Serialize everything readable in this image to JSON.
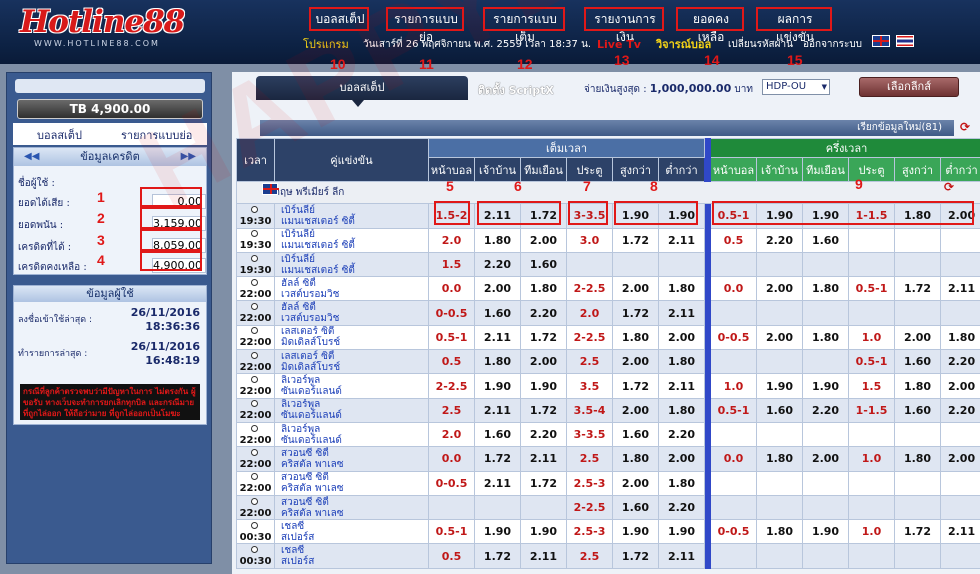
{
  "header": {
    "logo": "Hotline88",
    "logo_sub": "WWW.HOTLINE88.COM",
    "menu": [
      {
        "label": "บอลสเต็ป",
        "num": "10"
      },
      {
        "label": "รายการแบบย่อ",
        "num": "11"
      },
      {
        "label": "รายการแบบเต็ม",
        "num": "12"
      },
      {
        "label": "รายงานการเงิน",
        "num": "13"
      },
      {
        "label": "ยอดคงเหลือ",
        "num": "14"
      },
      {
        "label": "ผลการแข่งขัน",
        "num": "15"
      }
    ],
    "promo": "โปรแกรม",
    "datetime": "วันเสาร์ที่ 26 พฤศจิกายน พ.ศ. 2559 เวลา 18:37 น.",
    "livetv": "Live Tv",
    "analysis": "วิจารณ์บอล",
    "change_password": "เปลี่ยนรหัสผ่าน",
    "logout": "ออกจากระบบ",
    "colors": {
      "accent_red": "#e01818",
      "yellow": "#f5d416",
      "nav_bg": "#0d2244"
    }
  },
  "left": {
    "balance": "TB 4,900.00",
    "tabs": [
      "บอลสเต็ป",
      "รายการแบบย่อ"
    ],
    "credit_title": "ข้อมูลเครดิต",
    "username_label": "ชื่อผู้ใช้ :",
    "credit_rows": [
      {
        "label": "ยอดได้เสีย :",
        "value": "0.00",
        "num": "1"
      },
      {
        "label": "ยอดพนัน :",
        "value": "3,159.00",
        "num": "2"
      },
      {
        "label": "เครดิตที่ได้ :",
        "value": "8,059.00",
        "num": "3"
      },
      {
        "label": "เครดิตคงเหลือ :",
        "value": "4,900.00",
        "num": "4"
      }
    ],
    "user_title": "ข้อมูลผู้ใช้",
    "last_login_label": "ลงชื่อเข้าใช้ล่าสุด :",
    "last_login": "26/11/2016",
    "last_login_time": "18:36:36",
    "last_tx_label": "ทำรายการล่าสุด :",
    "last_tx": "26/11/2016",
    "last_tx_time": "16:48:19",
    "notice": "กรณีที่ลูกค้าตรวจพบว่ามีปัญหาในการ ไม่ตรงกัน ผู้ขอรับ ทางเว็บจะทำการยกเลิกทุกบิล และกรณีมายที่ถูกไล่ออก ให้ถือว่ามาย ที่ถูกไล่ออกเป็นโมฆะ"
  },
  "main": {
    "tab_label": "บอลสเต็ป",
    "script_tab": "ติดตั้ง ScriptX",
    "max_pay_label": "จ่ายเงินสูงสุด :",
    "max_pay_value": "1,000,000.00",
    "max_pay_unit": "บาท",
    "market": "HDP-OU",
    "league_button": "เลือกลีกส์",
    "refresh": "เรียกข้อมูลใหม่(81)",
    "col_time": "เวลา",
    "col_match": "คู่แข่งขัน",
    "ft_header": "เต็มเวลา",
    "ht_header": "ครึ่งเวลา",
    "sub_headers": [
      "หน้าบอล",
      "เจ้าบ้าน",
      "ทีมเยือน",
      "ประตู",
      "สูงกว่า",
      "ต่ำกว่า"
    ],
    "ann_nums": [
      "5",
      "6",
      "7",
      "8",
      "9"
    ],
    "league": "อังกฤษ พรีเมียร์ ลีก",
    "watermark": "HAPPYBET88",
    "rows": [
      {
        "t": "19:30",
        "h": "เบิร์นลี่ย์",
        "a": "แมนเชสเตอร์ ซิตี้",
        "ftH": "1.5-2",
        "ftHo": "2.11",
        "ftAo": "1.72",
        "ftG": "3-3.5",
        "ftO": "1.90",
        "ftU": "1.90",
        "htH": "0.5-1",
        "htHo": "1.90",
        "htAo": "1.90",
        "htG": "1-1.5",
        "htO": "1.80",
        "htU": "2.00"
      },
      {
        "t": "19:30",
        "h": "เบิร์นลี่ย์",
        "a": "แมนเชสเตอร์ ซิตี้",
        "ftH": "2.0",
        "ftHo": "1.80",
        "ftAo": "2.00",
        "ftG": "3.0",
        "ftO": "1.72",
        "ftU": "2.11",
        "htH": "0.5",
        "htHo": "2.20",
        "htAo": "1.60",
        "htG": "",
        "htO": "",
        "htU": ""
      },
      {
        "t": "19:30",
        "h": "เบิร์นลี่ย์",
        "a": "แมนเชสเตอร์ ซิตี้",
        "ftH": "1.5",
        "ftHo": "2.20",
        "ftAo": "1.60",
        "ftG": "",
        "ftO": "",
        "ftU": "",
        "htH": "",
        "htHo": "",
        "htAo": "",
        "htG": "",
        "htO": "",
        "htU": ""
      },
      {
        "t": "22:00",
        "h": "ฮัลล์ ซิตี้",
        "a": "เวสต์บรอมวิช",
        "ftH": "0.0",
        "ftHo": "2.00",
        "ftAo": "1.80",
        "ftG": "2-2.5",
        "ftO": "2.00",
        "ftU": "1.80",
        "htH": "0.0",
        "htHo": "2.00",
        "htAo": "1.80",
        "htG": "0.5-1",
        "htO": "1.72",
        "htU": "2.11"
      },
      {
        "t": "22:00",
        "h": "ฮัลล์ ซิตี้",
        "a": "เวสต์บรอมวิช",
        "ftH": "0-0.5",
        "ftHo": "1.60",
        "ftAo": "2.20",
        "ftG": "2.0",
        "ftO": "1.72",
        "ftU": "2.11",
        "htH": "",
        "htHo": "",
        "htAo": "",
        "htG": "",
        "htO": "",
        "htU": ""
      },
      {
        "t": "22:00",
        "h": "เลสเตอร์ ซิตี้",
        "a": "มิดเดิลส์โบรช์",
        "ftH": "0.5-1",
        "ftHo": "2.11",
        "ftAo": "1.72",
        "ftG": "2-2.5",
        "ftO": "1.80",
        "ftU": "2.00",
        "htH": "0-0.5",
        "htHo": "2.00",
        "htAo": "1.80",
        "htG": "1.0",
        "htO": "2.00",
        "htU": "1.80"
      },
      {
        "t": "22:00",
        "h": "เลสเตอร์ ซิตี้",
        "a": "มิดเดิลส์โบรช์",
        "ftH": "0.5",
        "ftHo": "1.80",
        "ftAo": "2.00",
        "ftG": "2.5",
        "ftO": "2.00",
        "ftU": "1.80",
        "htH": "",
        "htHo": "",
        "htAo": "",
        "htG": "0.5-1",
        "htO": "1.60",
        "htU": "2.20"
      },
      {
        "t": "22:00",
        "h": "ลิเวอร์พูล",
        "a": "ซันเดอร์แลนด์",
        "ftH": "2-2.5",
        "ftHo": "1.90",
        "ftAo": "1.90",
        "ftG": "3.5",
        "ftO": "1.72",
        "ftU": "2.11",
        "htH": "1.0",
        "htHo": "1.90",
        "htAo": "1.90",
        "htG": "1.5",
        "htO": "1.80",
        "htU": "2.00"
      },
      {
        "t": "22:00",
        "h": "ลิเวอร์พูล",
        "a": "ซันเดอร์แลนด์",
        "ftH": "2.5",
        "ftHo": "2.11",
        "ftAo": "1.72",
        "ftG": "3.5-4",
        "ftO": "2.00",
        "ftU": "1.80",
        "htH": "0.5-1",
        "htHo": "1.60",
        "htAo": "2.20",
        "htG": "1-1.5",
        "htO": "1.60",
        "htU": "2.20"
      },
      {
        "t": "22:00",
        "h": "ลิเวอร์พูล",
        "a": "ซันเดอร์แลนด์",
        "ftH": "2.0",
        "ftHo": "1.60",
        "ftAo": "2.20",
        "ftG": "3-3.5",
        "ftO": "1.60",
        "ftU": "2.20",
        "htH": "",
        "htHo": "",
        "htAo": "",
        "htG": "",
        "htO": "",
        "htU": ""
      },
      {
        "t": "22:00",
        "h": "สวอนซี ซิตี้",
        "a": "คริสตัล พาเลซ",
        "ftH": "0.0",
        "ftHo": "1.72",
        "ftAo": "2.11",
        "ftG": "2.5",
        "ftO": "1.80",
        "ftU": "2.00",
        "htH": "0.0",
        "htHo": "1.80",
        "htAo": "2.00",
        "htG": "1.0",
        "htO": "1.80",
        "htU": "2.00"
      },
      {
        "t": "22:00",
        "h": "สวอนซี ซิตี้",
        "a": "คริสตัล พาเลซ",
        "ftH": "0-0.5",
        "ftHo": "2.11",
        "ftAo": "1.72",
        "ftG": "2.5-3",
        "ftO": "2.00",
        "ftU": "1.80",
        "htH": "",
        "htHo": "",
        "htAo": "",
        "htG": "",
        "htO": "",
        "htU": ""
      },
      {
        "t": "22:00",
        "h": "สวอนซี ซิตี้",
        "a": "คริสตัล พาเลซ",
        "ftH": "",
        "ftHo": "",
        "ftAo": "",
        "ftG": "2-2.5",
        "ftO": "1.60",
        "ftU": "2.20",
        "htH": "",
        "htHo": "",
        "htAo": "",
        "htG": "",
        "htO": "",
        "htU": ""
      },
      {
        "t": "00:30",
        "h": "เชลซี",
        "a": "สเปอร์ส",
        "ftH": "0.5-1",
        "ftHo": "1.90",
        "ftAo": "1.90",
        "ftG": "2.5-3",
        "ftO": "1.90",
        "ftU": "1.90",
        "htH": "0-0.5",
        "htHo": "1.80",
        "htAo": "1.90",
        "htG": "1.0",
        "htO": "1.72",
        "htU": "2.11"
      },
      {
        "t": "00:30",
        "h": "เชลซี",
        "a": "สเปอร์ส",
        "ftH": "0.5",
        "ftHo": "1.72",
        "ftAo": "2.11",
        "ftG": "2.5",
        "ftO": "1.72",
        "ftU": "2.11",
        "htH": "",
        "htHo": "",
        "htAo": "",
        "htG": "",
        "htO": "",
        "htU": ""
      }
    ]
  }
}
